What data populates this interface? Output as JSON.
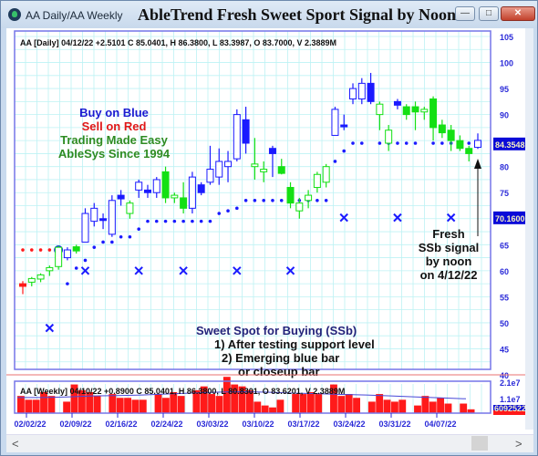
{
  "window": {
    "title": "AA Daily/AA Weekly",
    "chart_title": "AbleTrend Fresh Sweet Sport Signal by Noon",
    "buttons": {
      "minimize": "—",
      "maximize": "□",
      "close": "✕"
    },
    "scroll_left": "<",
    "scroll_right": ">"
  },
  "colors": {
    "up_blue": "#1a1aff",
    "down_green": "#14e014",
    "red": "#ff1a1a",
    "grid": "#bdf2f4",
    "axis_text": "#2a2ad8",
    "price_badge": "#0a0ad8",
    "price_badge_text": "#f5f0c0"
  },
  "chart_data": [
    {
      "type": "candlestick",
      "title": "AbleTrend Fresh Sweet Sport Signal by Noon",
      "header": "AA [Daily] 04/12/22  +2.5101 C 85.0401, H 86.3800, L 83.3987, O 83.7000, V 2.3889M",
      "ylim": [
        40,
        105
      ],
      "yticks": [
        105,
        100,
        95,
        90,
        80,
        75,
        65,
        60,
        55,
        50,
        45,
        40
      ],
      "grid": true,
      "price_labels": [
        {
          "value": 84.3548,
          "label": "84.3548"
        },
        {
          "value": 70.16,
          "label": "70.1600"
        }
      ],
      "candles": [
        {
          "o": 57.0,
          "h": 58.0,
          "l": 55.5,
          "c": 57.5,
          "color": "red",
          "hollow": false
        },
        {
          "o": 57.8,
          "h": 58.8,
          "l": 57.0,
          "c": 58.5,
          "color": "green",
          "hollow": true
        },
        {
          "o": 58.4,
          "h": 59.5,
          "l": 57.8,
          "c": 59.2,
          "color": "green",
          "hollow": true
        },
        {
          "o": 60.0,
          "h": 61.0,
          "l": 59.0,
          "c": 60.6,
          "color": "green",
          "hollow": true
        },
        {
          "o": 60.8,
          "h": 64.8,
          "l": 60.2,
          "c": 64.5,
          "color": "green",
          "hollow": true
        },
        {
          "o": 62.5,
          "h": 64.5,
          "l": 62.0,
          "c": 64.0,
          "color": "blue",
          "hollow": true
        },
        {
          "o": 64.6,
          "h": 65.0,
          "l": 63.3,
          "c": 63.8,
          "color": "green",
          "hollow": false
        },
        {
          "o": 65.5,
          "h": 72.0,
          "l": 65.5,
          "c": 71.0,
          "color": "blue",
          "hollow": true
        },
        {
          "o": 69.5,
          "h": 73.0,
          "l": 68.5,
          "c": 72.0,
          "color": "blue",
          "hollow": true
        },
        {
          "o": 70.0,
          "h": 71.0,
          "l": 68.0,
          "c": 70.0,
          "color": "blue",
          "hollow": false
        },
        {
          "o": 67.0,
          "h": 74.5,
          "l": 66.5,
          "c": 73.5,
          "color": "blue",
          "hollow": true
        },
        {
          "o": 74.5,
          "h": 75.5,
          "l": 72.5,
          "c": 73.8,
          "color": "blue",
          "hollow": false
        },
        {
          "o": 71.0,
          "h": 73.5,
          "l": 70.0,
          "c": 73.0,
          "color": "green",
          "hollow": true
        },
        {
          "o": 75.5,
          "h": 77.5,
          "l": 74.0,
          "c": 77.0,
          "color": "blue",
          "hollow": true
        },
        {
          "o": 75.0,
          "h": 76.5,
          "l": 74.0,
          "c": 75.5,
          "color": "blue",
          "hollow": false
        },
        {
          "o": 75.0,
          "h": 78.0,
          "l": 74.0,
          "c": 77.5,
          "color": "blue",
          "hollow": true
        },
        {
          "o": 79.0,
          "h": 80.0,
          "l": 73.0,
          "c": 74.0,
          "color": "green",
          "hollow": false
        },
        {
          "o": 74.0,
          "h": 75.0,
          "l": 73.0,
          "c": 74.5,
          "color": "green",
          "hollow": true
        },
        {
          "o": 74.0,
          "h": 77.0,
          "l": 71.0,
          "c": 72.0,
          "color": "green",
          "hollow": false
        },
        {
          "o": 72.0,
          "h": 79.0,
          "l": 71.0,
          "c": 78.0,
          "color": "blue",
          "hollow": true
        },
        {
          "o": 75.0,
          "h": 77.0,
          "l": 74.5,
          "c": 76.5,
          "color": "blue",
          "hollow": false
        },
        {
          "o": 77.0,
          "h": 84.0,
          "l": 76.5,
          "c": 79.5,
          "color": "blue",
          "hollow": true
        },
        {
          "o": 78.0,
          "h": 83.5,
          "l": 76.5,
          "c": 81.0,
          "color": "blue",
          "hollow": true
        },
        {
          "o": 80.0,
          "h": 83.0,
          "l": 77.0,
          "c": 81.0,
          "color": "blue",
          "hollow": true
        },
        {
          "o": 81.5,
          "h": 91.0,
          "l": 81.0,
          "c": 90.0,
          "color": "blue",
          "hollow": true
        },
        {
          "o": 89.0,
          "h": 91.5,
          "l": 82.5,
          "c": 84.5,
          "color": "blue",
          "hollow": false
        },
        {
          "o": 80.5,
          "h": 85.5,
          "l": 77.5,
          "c": 80.0,
          "color": "green",
          "hollow": true
        },
        {
          "o": 79.5,
          "h": 81.0,
          "l": 77.0,
          "c": 79.0,
          "color": "green",
          "hollow": true
        },
        {
          "o": 83.5,
          "h": 84.0,
          "l": 78.0,
          "c": 82.5,
          "color": "blue",
          "hollow": false
        },
        {
          "o": 80.0,
          "h": 81.5,
          "l": 78.5,
          "c": 78.7,
          "color": "green",
          "hollow": false
        },
        {
          "o": 76.0,
          "h": 77.0,
          "l": 72.0,
          "c": 73.0,
          "color": "green",
          "hollow": false
        },
        {
          "o": 71.5,
          "h": 74.0,
          "l": 70.0,
          "c": 73.0,
          "color": "green",
          "hollow": true
        },
        {
          "o": 73.5,
          "h": 75.5,
          "l": 72.0,
          "c": 74.5,
          "color": "green",
          "hollow": true
        },
        {
          "o": 76.0,
          "h": 79.0,
          "l": 75.0,
          "c": 78.5,
          "color": "green",
          "hollow": true
        },
        {
          "o": 77.0,
          "h": 80.5,
          "l": 76.0,
          "c": 80.0,
          "color": "green",
          "hollow": true
        },
        {
          "o": 86.0,
          "h": 91.5,
          "l": 86.0,
          "c": 91.0,
          "color": "blue",
          "hollow": true
        },
        {
          "o": 88.0,
          "h": 90.0,
          "l": 87.0,
          "c": 88.0,
          "color": "blue",
          "hollow": false
        },
        {
          "o": 93.0,
          "h": 96.0,
          "l": 92.0,
          "c": 95.0,
          "color": "blue",
          "hollow": true
        },
        {
          "o": 93.0,
          "h": 97.0,
          "l": 92.0,
          "c": 96.0,
          "color": "blue",
          "hollow": true
        },
        {
          "o": 96.0,
          "h": 98.0,
          "l": 92.0,
          "c": 92.5,
          "color": "blue",
          "hollow": false
        },
        {
          "o": 92.0,
          "h": 92.5,
          "l": 87.0,
          "c": 90.0,
          "color": "green",
          "hollow": true
        },
        {
          "o": 87.0,
          "h": 88.0,
          "l": 83.0,
          "c": 84.5,
          "color": "green",
          "hollow": true
        },
        {
          "o": 92.5,
          "h": 93.0,
          "l": 91.0,
          "c": 91.8,
          "color": "blue",
          "hollow": false
        },
        {
          "o": 91.5,
          "h": 92.0,
          "l": 89.0,
          "c": 90.0,
          "color": "green",
          "hollow": false
        },
        {
          "o": 91.5,
          "h": 92.5,
          "l": 87.0,
          "c": 90.5,
          "color": "green",
          "hollow": false
        },
        {
          "o": 91.0,
          "h": 91.5,
          "l": 89.0,
          "c": 90.5,
          "color": "green",
          "hollow": true
        },
        {
          "o": 93.0,
          "h": 93.5,
          "l": 85.0,
          "c": 87.5,
          "color": "green",
          "hollow": false
        },
        {
          "o": 88.0,
          "h": 89.0,
          "l": 85.5,
          "c": 86.5,
          "color": "green",
          "hollow": false
        },
        {
          "o": 87.0,
          "h": 88.0,
          "l": 83.0,
          "c": 85.0,
          "color": "green",
          "hollow": false
        },
        {
          "o": 85.0,
          "h": 86.0,
          "l": 83.0,
          "c": 83.5,
          "color": "green",
          "hollow": false
        },
        {
          "o": 83.5,
          "h": 84.0,
          "l": 81.0,
          "c": 82.5,
          "color": "green",
          "hollow": false
        },
        {
          "o": 83.7,
          "h": 86.38,
          "l": 83.4,
          "c": 85.04,
          "color": "blue",
          "hollow": true
        }
      ],
      "support_dots": [
        {
          "i": 0,
          "v": 64.0,
          "color": "red"
        },
        {
          "i": 1,
          "v": 64.0,
          "color": "red"
        },
        {
          "i": 2,
          "v": 64.0,
          "color": "red"
        },
        {
          "i": 3,
          "v": 64.0,
          "color": "red"
        },
        {
          "i": 4,
          "v": 64.0,
          "color": "blue",
          "big": true
        },
        {
          "i": 5,
          "v": 57.5,
          "color": "blue"
        },
        {
          "i": 6,
          "v": 60.5,
          "color": "blue"
        },
        {
          "i": 7,
          "v": 62.0,
          "color": "blue"
        },
        {
          "i": 8,
          "v": 64.5,
          "color": "blue"
        },
        {
          "i": 9,
          "v": 65.5,
          "color": "blue"
        },
        {
          "i": 10,
          "v": 65.5,
          "color": "blue"
        },
        {
          "i": 11,
          "v": 66.5,
          "color": "blue"
        },
        {
          "i": 12,
          "v": 66.5,
          "color": "blue"
        },
        {
          "i": 13,
          "v": 68.0,
          "color": "blue"
        },
        {
          "i": 14,
          "v": 69.5,
          "color": "blue"
        },
        {
          "i": 15,
          "v": 69.5,
          "color": "blue"
        },
        {
          "i": 16,
          "v": 69.5,
          "color": "blue"
        },
        {
          "i": 17,
          "v": 69.5,
          "color": "blue"
        },
        {
          "i": 18,
          "v": 69.5,
          "color": "blue"
        },
        {
          "i": 19,
          "v": 69.5,
          "color": "blue"
        },
        {
          "i": 20,
          "v": 69.5,
          "color": "blue"
        },
        {
          "i": 21,
          "v": 69.5,
          "color": "blue"
        },
        {
          "i": 22,
          "v": 71.0,
          "color": "blue"
        },
        {
          "i": 23,
          "v": 71.5,
          "color": "blue"
        },
        {
          "i": 24,
          "v": 72.0,
          "color": "blue"
        },
        {
          "i": 25,
          "v": 73.5,
          "color": "blue"
        },
        {
          "i": 26,
          "v": 73.5,
          "color": "blue"
        },
        {
          "i": 27,
          "v": 73.5,
          "color": "blue"
        },
        {
          "i": 28,
          "v": 73.5,
          "color": "blue"
        },
        {
          "i": 29,
          "v": 73.5,
          "color": "blue"
        },
        {
          "i": 30,
          "v": 73.5,
          "color": "blue"
        },
        {
          "i": 31,
          "v": 73.5,
          "color": "blue"
        },
        {
          "i": 32,
          "v": 73.5,
          "color": "blue"
        },
        {
          "i": 33,
          "v": 73.5,
          "color": "blue"
        },
        {
          "i": 34,
          "v": 73.5,
          "color": "blue"
        },
        {
          "i": 35,
          "v": 81.0,
          "color": "blue"
        },
        {
          "i": 36,
          "v": 83.0,
          "color": "blue"
        },
        {
          "i": 37,
          "v": 84.5,
          "color": "blue"
        },
        {
          "i": 38,
          "v": 84.5,
          "color": "blue"
        },
        {
          "i": 40,
          "v": 84.5,
          "color": "blue"
        },
        {
          "i": 41,
          "v": 84.5,
          "color": "blue"
        },
        {
          "i": 42,
          "v": 84.5,
          "color": "blue"
        },
        {
          "i": 43,
          "v": 84.5,
          "color": "blue"
        },
        {
          "i": 44,
          "v": 84.5,
          "color": "blue"
        },
        {
          "i": 46,
          "v": 84.5,
          "color": "blue"
        },
        {
          "i": 47,
          "v": 84.5,
          "color": "blue"
        },
        {
          "i": 48,
          "v": 84.5,
          "color": "blue"
        },
        {
          "i": 49,
          "v": 84.5,
          "color": "blue"
        },
        {
          "i": 50,
          "v": 84.5,
          "color": "blue"
        },
        {
          "i": 51,
          "v": 84.5,
          "color": "blue"
        }
      ],
      "x_markers": [
        {
          "i": 3,
          "v": 49.0
        },
        {
          "i": 7,
          "v": 60.0
        },
        {
          "i": 13,
          "v": 60.0
        },
        {
          "i": 18,
          "v": 60.0
        },
        {
          "i": 24,
          "v": 60.0
        },
        {
          "i": 30,
          "v": 60.0
        },
        {
          "i": 36,
          "v": 70.2
        },
        {
          "i": 42,
          "v": 70.2
        },
        {
          "i": 48,
          "v": 70.2
        }
      ],
      "annotations": {
        "legend_lines": [
          {
            "text": "Buy on Blue",
            "color": "#1a1ad0"
          },
          {
            "text": "Sell on Red",
            "color": "#e01818"
          },
          {
            "text": "Trading Made Easy",
            "color": "#2e8b22"
          },
          {
            "text": "AbleSys Since 1994",
            "color": "#2e8b22"
          }
        ],
        "ssb_title": "Sweet Spot for Buying (SSb)",
        "ssb_lines": [
          "1) After testing support level",
          "2) Emerging blue bar",
          "or closeup bar"
        ],
        "fresh_lines": [
          "Fresh",
          "SSb signal",
          "by noon",
          "on 4/12/22"
        ]
      }
    },
    {
      "type": "bar",
      "title": "AA Weekly volume",
      "header": "AA [Weekly] 04/10/22  +0.8900 C 85.0401, H 86.3800, L 80.8301, O 83.6201, V 2.3889M",
      "yticks": [
        "2.1e7",
        "1.1e7"
      ],
      "price_label": "6092522",
      "categories": [
        "02/02/22",
        "02/09/22",
        "02/16/22",
        "02/24/22",
        "03/03/22",
        "03/10/22",
        "03/17/22",
        "03/24/22",
        "03/31/22",
        "04/07/22"
      ],
      "values": [
        0.9,
        0.7,
        0.7,
        1.1,
        0.9,
        0,
        0.6,
        1.5,
        1.2,
        1.1,
        0.9,
        0,
        1.0,
        0.8,
        0.8,
        0.7,
        0.7,
        0,
        1.0,
        0.8,
        1.1,
        0.9,
        0,
        1.2,
        1.4,
        1.0,
        0.9,
        1.9,
        1.5,
        1.4,
        1.2,
        0.6,
        0.4,
        0.3,
        0.7,
        0,
        1.0,
        1.0,
        1.1,
        1.0,
        0,
        1.5,
        0.9,
        1.0,
        0.8,
        0,
        0.6,
        1.0,
        0.7,
        0.6,
        0.7,
        0,
        0.4,
        0.9,
        0.6,
        0.8,
        0.5,
        0,
        0.5,
        0.2
      ],
      "avg_line": [
        0.82,
        0.82,
        0.85,
        0.9,
        0.92,
        0.95,
        1.0,
        1.05,
        1.1,
        1.12,
        1.1,
        1.05,
        1.02,
        0.98,
        0.95,
        0.9,
        0.85,
        0.8,
        0.75
      ],
      "ymax": 2.1
    }
  ]
}
